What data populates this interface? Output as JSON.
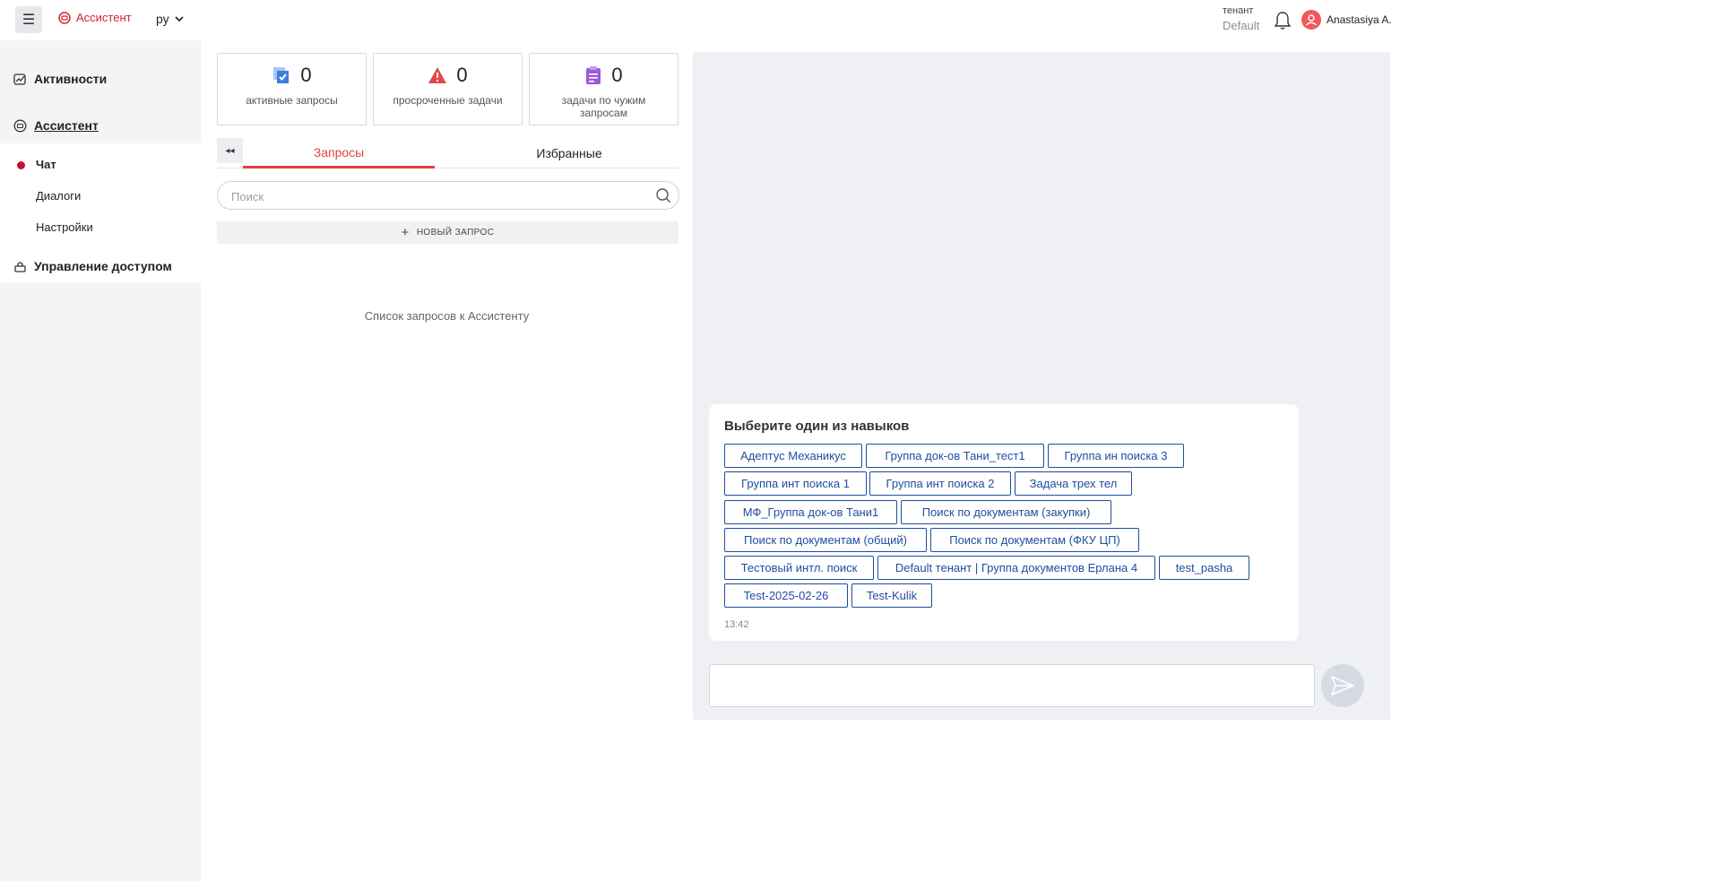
{
  "header": {
    "menu_icon": "hamburger-icon",
    "brand_label": "Ассистент",
    "language": "ру",
    "tenant_label": "тенант",
    "tenant_value": "Default",
    "user_name": "Anastasiya A.",
    "accent_color": "#d1232a"
  },
  "sidebar": {
    "items": [
      {
        "label": "Активности",
        "icon": "activity-icon"
      },
      {
        "label": "Ассистент",
        "icon": "assistant-icon"
      },
      {
        "label": "Управление доступом",
        "icon": "access-icon"
      }
    ],
    "subitems": [
      {
        "label": "Чат",
        "active": true
      },
      {
        "label": "Диалоги"
      },
      {
        "label": "Настройки"
      }
    ]
  },
  "stats": [
    {
      "value": "0",
      "label": "активные запросы",
      "icon": "checklist-icon",
      "color": "#3b7de0"
    },
    {
      "value": "0",
      "label": "просроченные задачи",
      "icon": "warning-icon",
      "color": "#e34848"
    },
    {
      "value": "0",
      "label": "задачи по чужим запросам",
      "icon": "clipboard-icon",
      "color": "#9b59d6"
    }
  ],
  "tabs": {
    "collapse_label": "◂◂",
    "items": [
      {
        "label": "Запросы",
        "active": true
      },
      {
        "label": "Избранные",
        "active": false
      }
    ]
  },
  "search": {
    "placeholder": "Поиск",
    "value": ""
  },
  "new_request_label": "НОВЫЙ ЗАПРОС",
  "empty_text": "Список запросов к Ассистенту",
  "chat": {
    "prompt_title": "Выберите один из навыков",
    "skills": [
      "Адептус Механикус",
      "Группа док-ов Тани_тест1",
      "Группа ин поиска 3",
      "Группа инт поиска 1",
      "Группа инт поиска 2",
      "Задача трех тел",
      "МФ_Группа док-ов Тани1",
      "Поиск по документам (закупки)",
      "Поиск по документам (общий)",
      "Поиск по документам (ФКУ ЦП)",
      "Тестовый интл. поиск",
      "Default тенант | Группа документов Ерлана 4",
      "test_pasha",
      "Test-2025-02-26",
      "Test-Kulik"
    ],
    "timestamp": "13:42",
    "input_value": "",
    "send_icon": "send-icon"
  }
}
